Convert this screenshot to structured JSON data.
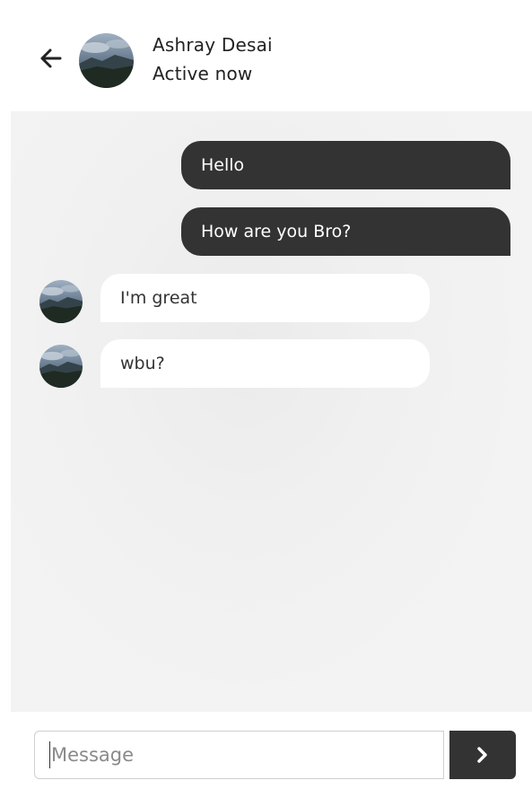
{
  "header": {
    "contact_name": "Ashray Desai",
    "status": "Active now"
  },
  "icons": {
    "back": "arrow-left-icon",
    "send": "chevron-right-icon"
  },
  "messages": [
    {
      "direction": "outgoing",
      "text": "Hello"
    },
    {
      "direction": "outgoing",
      "text": "How are you Bro?"
    },
    {
      "direction": "incoming",
      "text": "I'm great"
    },
    {
      "direction": "incoming",
      "text": "wbu?"
    }
  ],
  "composer": {
    "placeholder": "Message",
    "value": ""
  },
  "colors": {
    "bubble_outgoing": "#333333",
    "bubble_incoming": "#ffffff",
    "chat_background": "#f3f3f3",
    "send_button": "#333333",
    "accent": "#1d5b63"
  }
}
